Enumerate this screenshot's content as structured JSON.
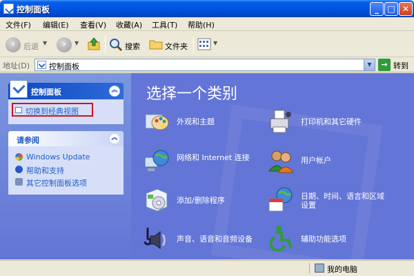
{
  "window": {
    "title": "控制面板"
  },
  "menubar": {
    "items": [
      "文件(F)",
      "编辑(E)",
      "查看(V)",
      "收藏(A)",
      "工具(T)",
      "帮助(H)"
    ]
  },
  "toolbar": {
    "back": "后退",
    "search": "搜索",
    "folders": "文件夹"
  },
  "address": {
    "label": "地址(D)",
    "value": "控制面板",
    "go": "转到"
  },
  "taskpane": {
    "panel_title": "控制面板",
    "classic_link": "切换到经典视图",
    "see_also_title": "请参阅",
    "see_also": [
      "Windows Update",
      "帮助和支持",
      "其它控制面板选项"
    ]
  },
  "main": {
    "heading": "选择一个类别",
    "categories": [
      "外观和主题",
      "打印机和其它硬件",
      "网络和 Internet 连接",
      "用户帐户",
      "添加/删除程序",
      "日期、时间、语言和区域设置",
      "声音、语音和音频设备",
      "辅助功能选项"
    ]
  },
  "status": {
    "text": "我的电脑"
  },
  "colors": {
    "accent": "#0054e3",
    "pane": "#6375d6",
    "link": "#215dc6",
    "highlight": "#d0121b"
  }
}
